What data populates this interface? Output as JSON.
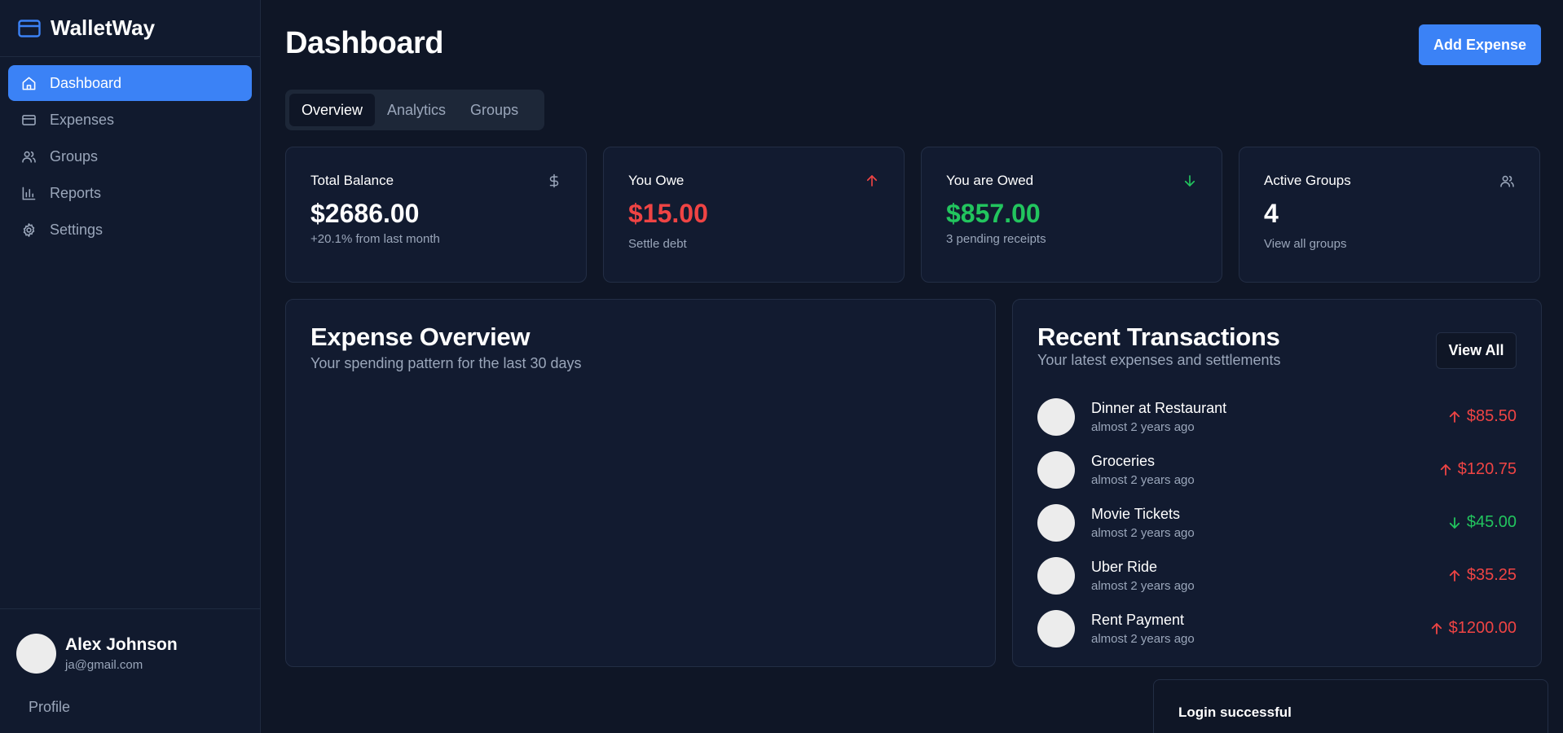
{
  "app": {
    "name": "WalletWay"
  },
  "sidebar": {
    "items": [
      {
        "label": "Dashboard",
        "icon": "home-icon",
        "active": true
      },
      {
        "label": "Expenses",
        "icon": "credit-card-icon",
        "active": false
      },
      {
        "label": "Groups",
        "icon": "users-icon",
        "active": false
      },
      {
        "label": "Reports",
        "icon": "bar-chart-icon",
        "active": false
      },
      {
        "label": "Settings",
        "icon": "gear-icon",
        "active": false
      }
    ],
    "user": {
      "name": "Alex Johnson",
      "email": "ja@gmail.com"
    },
    "profile_label": "Profile"
  },
  "header": {
    "title": "Dashboard",
    "add_label": "Add Expense"
  },
  "tabs": [
    {
      "label": "Overview",
      "active": true
    },
    {
      "label": "Analytics",
      "active": false
    },
    {
      "label": "Groups",
      "active": false
    }
  ],
  "stats": [
    {
      "label": "Total Balance",
      "value": "$2686.00",
      "sub": "+20.1% from last month",
      "icon": "dollar-icon",
      "tone": "neutral"
    },
    {
      "label": "You Owe",
      "value": "$15.00",
      "sub": "Settle debt",
      "icon": "arrow-up-icon",
      "tone": "red"
    },
    {
      "label": "You are Owed",
      "value": "$857.00",
      "sub": "3 pending receipts",
      "icon": "arrow-down-icon",
      "tone": "green"
    },
    {
      "label": "Active Groups",
      "value": "4",
      "sub": "View all groups",
      "icon": "users-icon",
      "tone": "neutral"
    }
  ],
  "expense_overview": {
    "title": "Expense Overview",
    "subtitle": "Your spending pattern for the last 30 days"
  },
  "recent_transactions": {
    "title": "Recent Transactions",
    "subtitle": "Your latest expenses and settlements",
    "view_all_label": "View All",
    "items": [
      {
        "name": "Dinner at Restaurant",
        "time": "almost 2 years ago",
        "amount": "$85.50",
        "direction": "up"
      },
      {
        "name": "Groceries",
        "time": "almost 2 years ago",
        "amount": "$120.75",
        "direction": "up"
      },
      {
        "name": "Movie Tickets",
        "time": "almost 2 years ago",
        "amount": "$45.00",
        "direction": "down"
      },
      {
        "name": "Uber Ride",
        "time": "almost 2 years ago",
        "amount": "$35.25",
        "direction": "up"
      },
      {
        "name": "Rent Payment",
        "time": "almost 2 years ago",
        "amount": "$1200.00",
        "direction": "up"
      }
    ]
  },
  "toast": {
    "message": "Login successful"
  },
  "colors": {
    "accent": "#3b82f6",
    "red": "#ef4444",
    "green": "#22c55e",
    "background": "#0f1626",
    "panel": "#121b30"
  }
}
